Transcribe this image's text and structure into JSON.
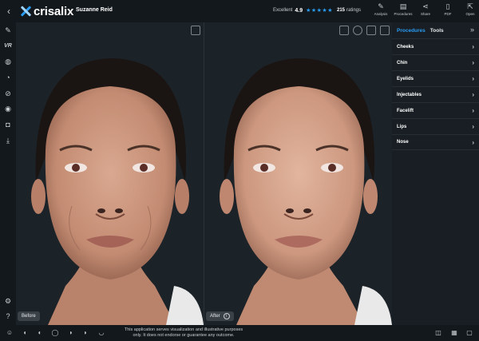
{
  "header": {
    "back_icon": "chevron-left-icon",
    "brand": "crisalix",
    "patient_name": "Suzanne Reid",
    "rating": {
      "label": "Excellent",
      "score": "4.9",
      "stars": "★★★★★",
      "count": "215",
      "count_label": "ratings"
    },
    "actions": [
      {
        "label": "Analysis",
        "icon": "pencil-icon"
      },
      {
        "label": "Procedures",
        "icon": "clipboard-icon"
      },
      {
        "label": "Share",
        "icon": "share-icon"
      },
      {
        "label": "PDF",
        "icon": "document-icon"
      },
      {
        "label": "Open",
        "icon": "open-icon"
      }
    ]
  },
  "left_tools": {
    "vr_label": "VR",
    "icons": [
      "pencil-icon",
      "vr-icon",
      "globe-icon",
      "camera-rotate-icon",
      "eye-off-icon",
      "record-icon",
      "camera-icon",
      "download-icon",
      "settings-icon",
      "help-icon"
    ]
  },
  "viewer": {
    "before_label": "Before",
    "after_label": "After",
    "info_symbol": "i"
  },
  "sidebar": {
    "tabs": [
      {
        "label": "Procedures",
        "active": true
      },
      {
        "label": "Tools",
        "active": false
      }
    ],
    "procedures": [
      "Cheeks",
      "Chin",
      "Eyelids",
      "Injectables",
      "Facelift",
      "Lips",
      "Nose"
    ]
  },
  "footer": {
    "disclaimer_line1": "This application serves visualization and illustrative purposes",
    "disclaimer_line2": "only. It does not endorse or guarantee any outcome."
  },
  "colors": {
    "accent": "#2a9df4",
    "background": "#13181d",
    "viewer_bg": "#1c2328",
    "sidebar_bg": "#181e23"
  }
}
